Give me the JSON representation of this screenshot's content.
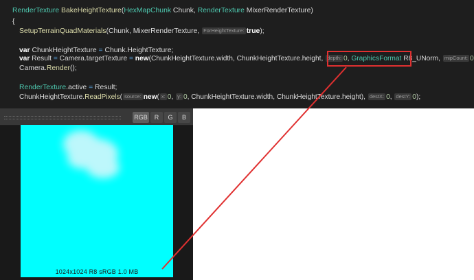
{
  "code": {
    "l1": {
      "t1": "RenderTexture",
      "t2": "BakeHeightTexture",
      "t3": "(",
      "t4": "HexMapChunk",
      "t5": " Chunk, ",
      "t6": "RenderTexture",
      "t7": " MixerRenderTexture)"
    },
    "l2": {
      "t1": "{"
    },
    "l3": {
      "t1": "SetupTerrainQuadMaterials",
      "t2": "(Chunk, MixerRenderTexture, ",
      "hint": "ForHeightTexture:",
      "t3": "true",
      "t4": ");"
    },
    "l5": {
      "t1": "var",
      "t2": " ChunkHeightTexture ",
      "t3": "=",
      "t4": " Chunk.HeightTexture;"
    },
    "l6": {
      "t1": "var",
      "t2": " Result ",
      "t3": "=",
      "t4": " Camera.targetTexture ",
      "t5": "=",
      "t6": " ",
      "t7": "new",
      "t8": "(ChunkHeightTexture.width, ChunkHeightTexture.height, ",
      "hint1": "depth:",
      "t9": "0",
      "t10": ", ",
      "t11": "GraphicsFormat",
      "t12": " R8_UNorm, ",
      "hint2": "mipCount:",
      "t13": "0",
      "t14": ");"
    },
    "l7": {
      "t1": "Camera.",
      "t2": "Render",
      "t3": "();"
    },
    "l9": {
      "t1": "RenderTexture",
      "t2": ".active ",
      "t3": "=",
      "t4": " Result;"
    },
    "l10": {
      "t1": "ChunkHeightTexture.",
      "t2": "ReadPixels",
      "t3": "(",
      "hint1": "source:",
      "t4": "new",
      "t5": "(",
      "hint2": "x:",
      "t6": "0",
      "t7": ", ",
      "hint3": "y:",
      "t8": "0",
      "t9": ", ChunkHeightTexture.width, ChunkHeightTexture.height), ",
      "hint4": "destX:",
      "t10": "0",
      "t11": ", ",
      "hint5": "destY:",
      "t12": "0",
      "t13": ");"
    }
  },
  "preview": {
    "channels": [
      "RGB",
      "R",
      "G",
      "B"
    ],
    "info": "1024x1024   R8 sRGB   1.0 MB",
    "texture_color": "#00ffff"
  },
  "annotation": {
    "color": "#e03030"
  }
}
